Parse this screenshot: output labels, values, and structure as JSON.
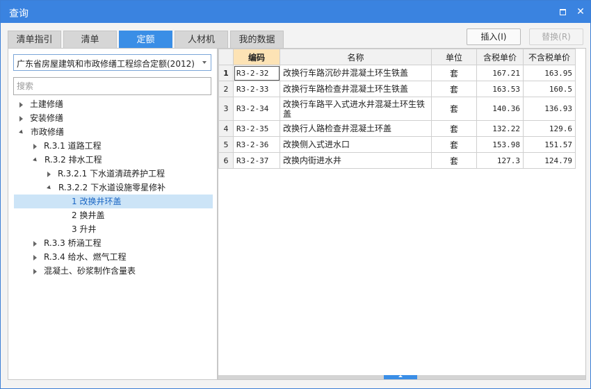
{
  "window": {
    "title": "查询"
  },
  "tabs": [
    "清单指引",
    "清单",
    "定额",
    "人材机",
    "我的数据"
  ],
  "active_tab": "定额",
  "actions": {
    "insert": "插入(I)",
    "replace": "替换(R)"
  },
  "left": {
    "dropdown_value": "广东省房屋建筑和市政修缮工程综合定额(2012)",
    "search_placeholder": "搜索",
    "tree": [
      {
        "label": "土建修缮",
        "state": "closed"
      },
      {
        "label": "安装修缮",
        "state": "closed"
      },
      {
        "label": "市政修缮",
        "state": "open"
      },
      {
        "label": "R.3.1 道路工程",
        "state": "closed"
      },
      {
        "label": "R.3.2 排水工程",
        "state": "open"
      },
      {
        "label": "R.3.2.1 下水道清疏养护工程",
        "state": "closed"
      },
      {
        "label": "R.3.2.2 下水道设施零星修补",
        "state": "open"
      },
      {
        "label": "1 改换井环盖",
        "state": "none",
        "selected": true
      },
      {
        "label": "2 换井盖",
        "state": "none"
      },
      {
        "label": "3 升井",
        "state": "none"
      },
      {
        "label": "R.3.3 桥涵工程",
        "state": "closed"
      },
      {
        "label": "R.3.4 给水、燃气工程",
        "state": "closed"
      },
      {
        "label": "混凝土、砂浆制作含量表",
        "state": "closed"
      }
    ]
  },
  "grid": {
    "headers": [
      "编码",
      "名称",
      "单位",
      "含税单价",
      "不含税单价"
    ],
    "rows": [
      {
        "no": "1",
        "code": "R3-2-32",
        "name": "改换行车路沉砂井混凝土环生铁盖",
        "unit": "套",
        "price_tax": "167.21",
        "price_notax": "163.95"
      },
      {
        "no": "2",
        "code": "R3-2-33",
        "name": "改换行车路检查井混凝土环生铁盖",
        "unit": "套",
        "price_tax": "163.53",
        "price_notax": "160.5"
      },
      {
        "no": "3",
        "code": "R3-2-34",
        "name": "改换行车路平入式进水井混凝土环生铁盖",
        "unit": "套",
        "price_tax": "140.36",
        "price_notax": "136.93"
      },
      {
        "no": "4",
        "code": "R3-2-35",
        "name": "改换行人路检查井混凝土环盖",
        "unit": "套",
        "price_tax": "132.22",
        "price_notax": "129.6"
      },
      {
        "no": "5",
        "code": "R3-2-36",
        "name": "改换侧入式进水口",
        "unit": "套",
        "price_tax": "153.98",
        "price_notax": "151.57"
      },
      {
        "no": "6",
        "code": "R3-2-37",
        "name": "改换内街进水井",
        "unit": "套",
        "price_tax": "127.3",
        "price_notax": "124.79"
      }
    ]
  }
}
